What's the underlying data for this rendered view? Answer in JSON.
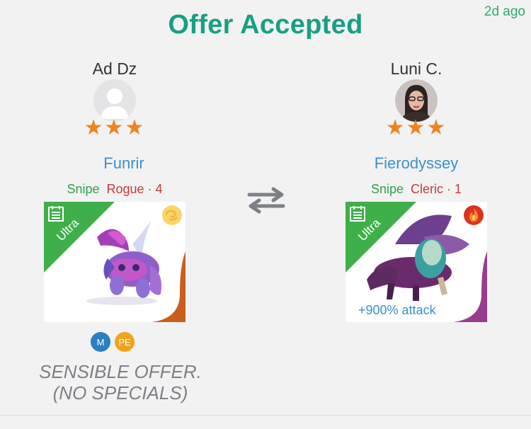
{
  "header": {
    "title": "Offer Accepted",
    "time_ago": "2d ago"
  },
  "left": {
    "player_name": "Ad Dz",
    "stars": "★★★",
    "dragon_name": "Funrir",
    "tag_snipe": "Snipe",
    "tag_class": "Rogue · 4",
    "ribbon_label": "Ultra",
    "badges": [
      "M",
      "PE"
    ],
    "badge_colors": [
      "#2a7fc0",
      "#f2a21c"
    ],
    "note_line1": "SENSIBLE OFFER.",
    "note_line2": "(NO SPECIALS)"
  },
  "right": {
    "player_name": "Luni C.",
    "stars": "★★★",
    "dragon_name": "Fierodyssey",
    "tag_snipe": "Snipe",
    "tag_class": "Cleric · 1",
    "ribbon_label": "Ultra",
    "stat_text": "+900% attack"
  },
  "icons": {
    "swap": "swap-arrows-icon",
    "left_element": "wind-element-icon",
    "right_element": "fire-element-icon",
    "left_sign": "taurus-icon",
    "right_sign": "aquarius-icon"
  },
  "colors": {
    "title": "#17a083",
    "ribbon": "#3fb049",
    "stars": "#f0831e",
    "link_blue": "#3a8fd0"
  }
}
